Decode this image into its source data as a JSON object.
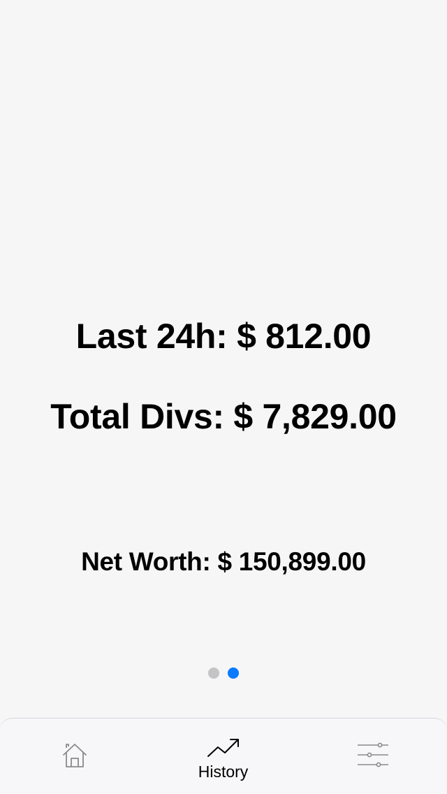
{
  "stats": {
    "last_24h": "Last 24h: $ 812.00",
    "total_divs": "Total Divs: $ 7,829.00",
    "net_worth": "Net Worth: $ 150,899.00"
  },
  "pager": {
    "page_count": 2,
    "current_page": 2,
    "active_color": "#0a7aff",
    "inactive_color": "#c4c4c6"
  },
  "tabbar": {
    "tabs": [
      {
        "icon": "home-icon",
        "label": "",
        "selected": false
      },
      {
        "icon": "trending-up-icon",
        "label": "History",
        "selected": true
      },
      {
        "icon": "sliders-icon",
        "label": "",
        "selected": false
      }
    ]
  }
}
